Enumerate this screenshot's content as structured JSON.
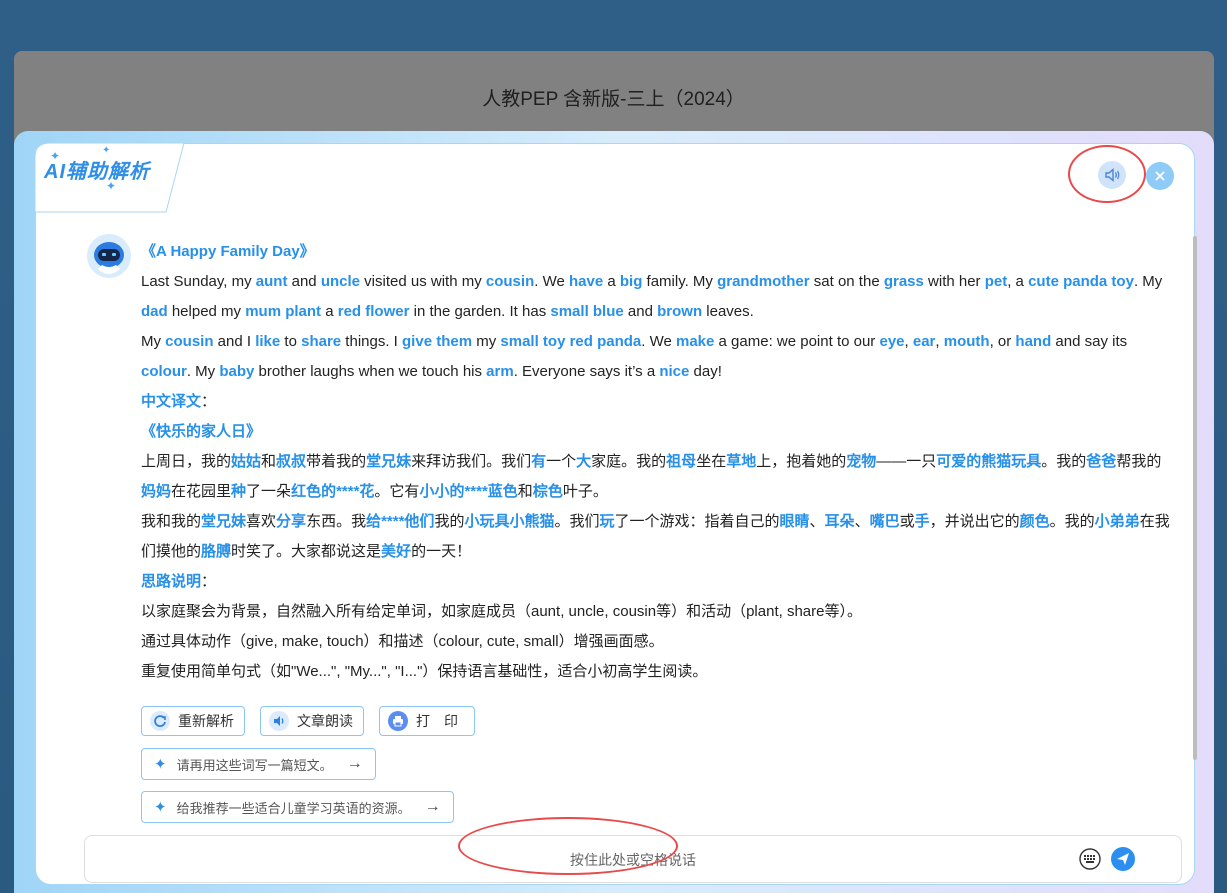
{
  "backdrop": {
    "title": "人教PEP 含新版-三上（2024）"
  },
  "modal": {
    "tab_title": "AI辅助解析",
    "colors": {
      "accent": "#2790e8",
      "ring": "#e8494a"
    }
  },
  "article": {
    "title": "《A Happy Family Day》",
    "en_p1": [
      {
        "t": "Last Sunday, my "
      },
      {
        "t": "aunt",
        "h": 1
      },
      {
        "t": " and "
      },
      {
        "t": "uncle",
        "h": 1
      },
      {
        "t": " visited us with my "
      },
      {
        "t": "cousin",
        "h": 1
      },
      {
        "t": ". We "
      },
      {
        "t": "have",
        "h": 1
      },
      {
        "t": " a "
      },
      {
        "t": "big",
        "h": 1
      },
      {
        "t": " family. My "
      },
      {
        "t": "grandmother",
        "h": 1
      },
      {
        "t": " sat on the "
      },
      {
        "t": "grass",
        "h": 1
      },
      {
        "t": " with her "
      },
      {
        "t": "pet",
        "h": 1
      },
      {
        "t": ", a "
      },
      {
        "t": "cute panda toy",
        "h": 1
      },
      {
        "t": ". My "
      },
      {
        "t": "dad",
        "h": 1
      },
      {
        "t": " helped my "
      },
      {
        "t": "mum plant",
        "h": 1
      },
      {
        "t": " a "
      },
      {
        "t": "red flower",
        "h": 1
      },
      {
        "t": " in the garden. It has "
      },
      {
        "t": "small blue",
        "h": 1
      },
      {
        "t": " and "
      },
      {
        "t": "brown",
        "h": 1
      },
      {
        "t": " leaves."
      }
    ],
    "en_p2": [
      {
        "t": "My "
      },
      {
        "t": "cousin",
        "h": 1
      },
      {
        "t": " and I "
      },
      {
        "t": "like",
        "h": 1
      },
      {
        "t": " to "
      },
      {
        "t": "share",
        "h": 1
      },
      {
        "t": " things. I "
      },
      {
        "t": "give them",
        "h": 1
      },
      {
        "t": " my "
      },
      {
        "t": "small toy red panda",
        "h": 1
      },
      {
        "t": ". We "
      },
      {
        "t": "make",
        "h": 1
      },
      {
        "t": " a game: we point to our "
      },
      {
        "t": "eye",
        "h": 1
      },
      {
        "t": ", "
      },
      {
        "t": "ear",
        "h": 1
      },
      {
        "t": ", "
      },
      {
        "t": "mouth",
        "h": 1
      },
      {
        "t": ", or "
      },
      {
        "t": "hand",
        "h": 1
      },
      {
        "t": " and say its "
      },
      {
        "t": "colour",
        "h": 1
      },
      {
        "t": ". My "
      },
      {
        "t": "baby",
        "h": 1
      },
      {
        "t": " brother laughs when we touch his "
      },
      {
        "t": "arm",
        "h": 1
      },
      {
        "t": ". Everyone says it’s a "
      },
      {
        "t": "nice",
        "h": 1
      },
      {
        "t": " day!"
      }
    ],
    "cn_heading": "中文译文",
    "cn_title": "《快乐的家人日》",
    "cn_p1": [
      {
        "t": "上周日，我的"
      },
      {
        "t": "姑姑",
        "h": 1
      },
      {
        "t": "和"
      },
      {
        "t": "叔叔",
        "h": 1
      },
      {
        "t": "带着我的"
      },
      {
        "t": "堂兄妹",
        "h": 1
      },
      {
        "t": "来拜访我们。我们"
      },
      {
        "t": "有",
        "h": 1
      },
      {
        "t": "一个"
      },
      {
        "t": "大",
        "h": 1
      },
      {
        "t": "家庭。我的"
      },
      {
        "t": "祖母",
        "h": 1
      },
      {
        "t": "坐在"
      },
      {
        "t": "草地",
        "h": 1
      },
      {
        "t": "上，抱着她的"
      },
      {
        "t": "宠物",
        "h": 1
      },
      {
        "t": "——一只"
      },
      {
        "t": "可爱的熊猫玩具",
        "h": 1
      },
      {
        "t": "。我的"
      },
      {
        "t": "爸爸",
        "h": 1
      },
      {
        "t": "帮我的"
      },
      {
        "t": "妈妈",
        "h": 1
      },
      {
        "t": "在花园里"
      },
      {
        "t": "种",
        "h": 1
      },
      {
        "t": "了一朵"
      },
      {
        "t": "红色的****花",
        "h": 1
      },
      {
        "t": "。它有"
      },
      {
        "t": "小小的****蓝色",
        "h": 1
      },
      {
        "t": "和"
      },
      {
        "t": "棕色",
        "h": 1
      },
      {
        "t": "叶子。"
      }
    ],
    "cn_p2": [
      {
        "t": "我和我的"
      },
      {
        "t": "堂兄妹",
        "h": 1
      },
      {
        "t": "喜欢"
      },
      {
        "t": "分享",
        "h": 1
      },
      {
        "t": "东西。我"
      },
      {
        "t": "给****他们",
        "h": 1
      },
      {
        "t": "我的"
      },
      {
        "t": "小玩具小熊猫",
        "h": 1
      },
      {
        "t": "。我们"
      },
      {
        "t": "玩",
        "h": 1
      },
      {
        "t": "了一个游戏：指着自己的"
      },
      {
        "t": "眼睛",
        "h": 1
      },
      {
        "t": "、"
      },
      {
        "t": "耳朵",
        "h": 1
      },
      {
        "t": "、"
      },
      {
        "t": "嘴巴",
        "h": 1
      },
      {
        "t": "或"
      },
      {
        "t": "手",
        "h": 1
      },
      {
        "t": "，并说出它的"
      },
      {
        "t": "颜色",
        "h": 1
      },
      {
        "t": "。我的"
      },
      {
        "t": "小弟弟",
        "h": 1
      },
      {
        "t": "在我们摸他的"
      },
      {
        "t": "胳膊",
        "h": 1
      },
      {
        "t": "时笑了。大家都说这是"
      },
      {
        "t": "美好",
        "h": 1
      },
      {
        "t": "的一天！"
      }
    ],
    "idea_heading": "思路说明",
    "ideas": [
      "以家庭聚会为背景，自然融入所有给定单词，如家庭成员（aunt, uncle, cousin等）和活动（plant, share等）。",
      "通过具体动作（give, make, touch）和描述（colour, cute, small）增强画面感。",
      "重复使用简单句式（如\"We...\", \"My...\", \"I...\"）保持语言基础性，适合小初高学生阅读。"
    ]
  },
  "actions": {
    "reanalyze": "重新解析",
    "read_aloud": "文章朗读",
    "print": "打　印"
  },
  "suggestions": [
    "请再用这些词写一篇短文。",
    "给我推荐一些适合儿童学习英语的资源。"
  ],
  "input": {
    "placeholder": "按住此处或空格说话"
  }
}
